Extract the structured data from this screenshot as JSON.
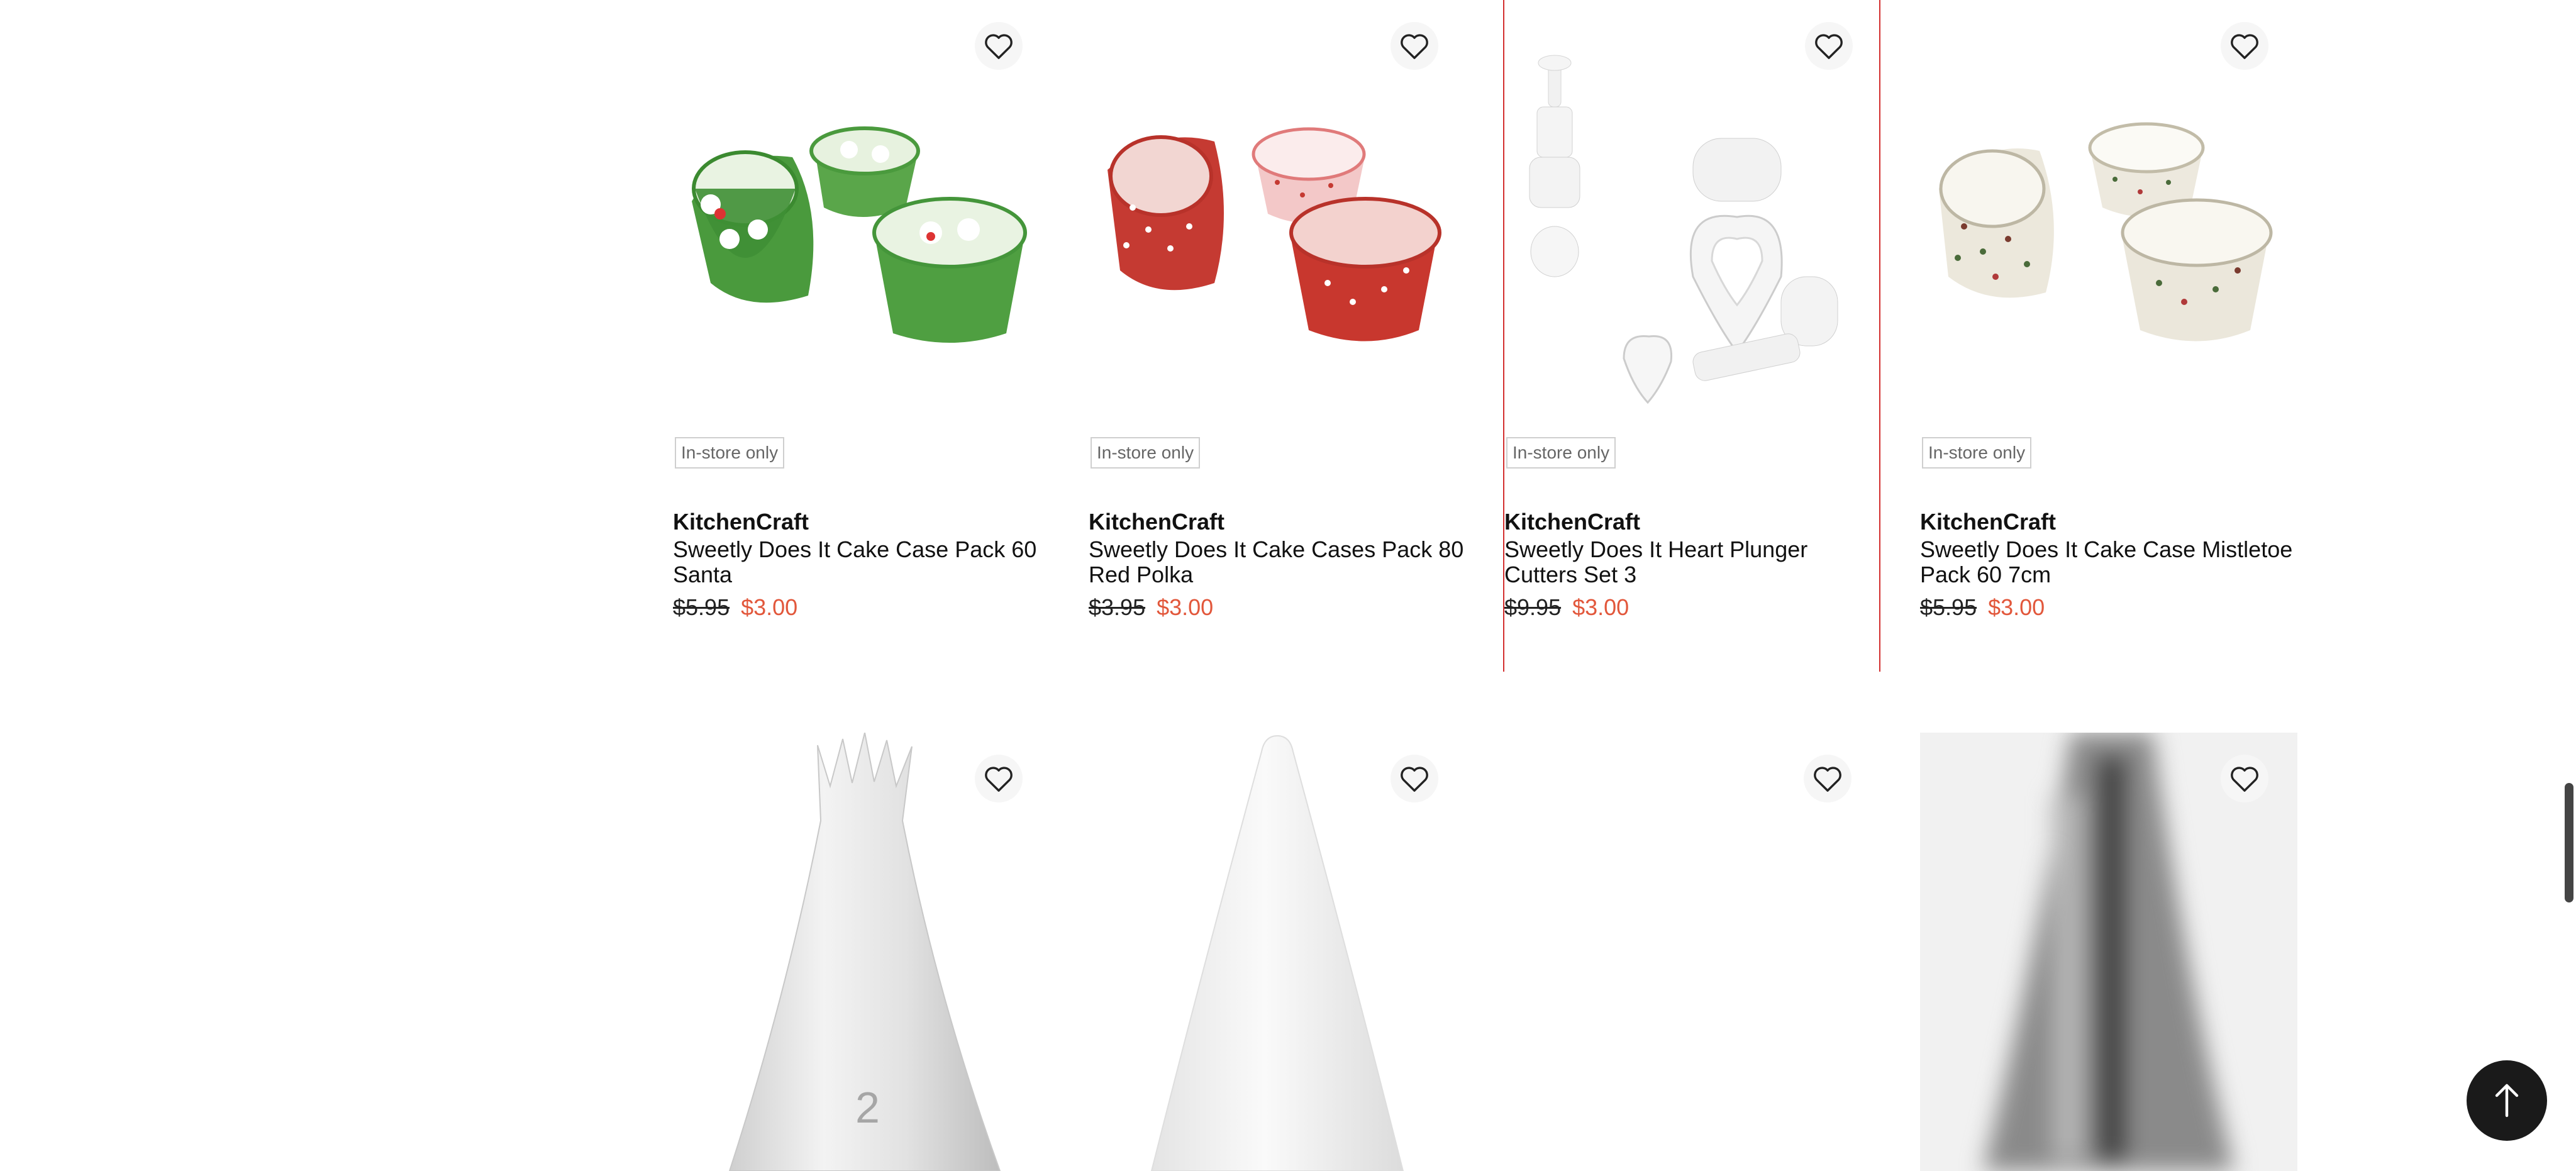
{
  "colors": {
    "accent": "#e2573b",
    "highlight_border": "#d32f2f",
    "button_bg": "#1a1a1a"
  },
  "products": [
    {
      "badge": "In-store only",
      "brand": "KitchenCraft",
      "name": "Sweetly Does It Cake Case Pack 60 Santa",
      "price_old": "$5.95",
      "price_new": "$3.00"
    },
    {
      "badge": "In-store only",
      "brand": "KitchenCraft",
      "name": "Sweetly Does It Cake Cases Pack 80 Red Polka",
      "price_old": "$3.95",
      "price_new": "$3.00"
    },
    {
      "badge": "In-store only",
      "brand": "KitchenCraft",
      "name": "Sweetly Does It Heart Plunger Cutters Set 3",
      "price_old": "$9.95",
      "price_new": "$3.00"
    },
    {
      "badge": "In-store only",
      "brand": "KitchenCraft",
      "name": "Sweetly Does It Cake Case Mistletoe Pack 60 7cm",
      "price_old": "$5.95",
      "price_new": "$3.00"
    }
  ],
  "icons": {
    "favorite": "heart-icon",
    "back_to_top": "arrow-up-icon"
  }
}
